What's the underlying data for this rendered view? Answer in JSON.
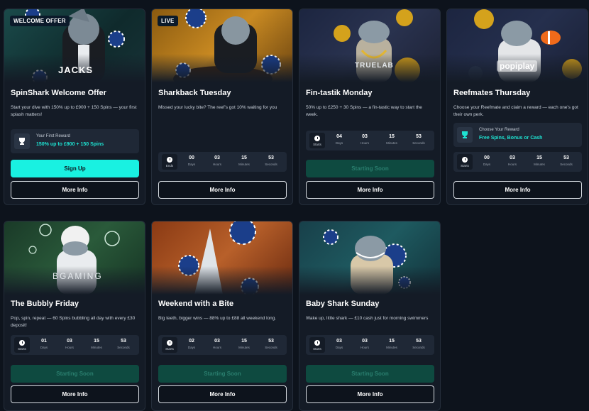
{
  "cards": [
    {
      "badge": "WELCOME OFFER",
      "title": "SpinShark Welcome Offer",
      "desc": "Start your dive with 150% up to £900 + 150 Spins — your first splash matters!",
      "reward_label": "Your First Reward",
      "reward_value": "150% up to £900 + 150 Spins",
      "signup_label": "Sign Up",
      "info_label": "More Info",
      "art_text": "JACKS"
    },
    {
      "badge": "LIVE",
      "title": "Sharkback Tuesday",
      "desc": "Missed your lucky bite? The reef's got 10% waiting for you",
      "timer_label": "Ends",
      "timer": [
        "00",
        "03",
        "15",
        "53"
      ],
      "info_label": "More Info"
    },
    {
      "title": "Fin-tastik Monday",
      "desc": "50% up to £250 + 30 Spins — a fin-tastic way to start the week.",
      "timer_label": "Starts",
      "timer": [
        "04",
        "03",
        "15",
        "53"
      ],
      "soon_label": "Starting Soon",
      "info_label": "More Info",
      "art_text": "TRUELAB"
    },
    {
      "title": "Reefmates Thursday",
      "desc": "Choose your Reefmate and claim a reward — each one's got their own perk.",
      "reward_label": "Choose Your Reward",
      "reward_value": "Free Spins, Bonus or Cash",
      "timer_label": "Starts",
      "timer": [
        "00",
        "03",
        "15",
        "53"
      ],
      "info_label": "More Info",
      "art_text": "popiplay"
    },
    {
      "title": "The Bubbly Friday",
      "desc": "Pop, spin, repeat — 60 Spins bubbling all day with every £30 deposit!",
      "timer_label": "Starts",
      "timer": [
        "01",
        "03",
        "15",
        "53"
      ],
      "soon_label": "Starting Soon",
      "info_label": "More Info",
      "art_text": "BGAMING"
    },
    {
      "title": "Weekend with a Bite",
      "desc": "Big teeth, bigger wins — 88% up to £88 all weekend long.",
      "timer_label": "Starts",
      "timer": [
        "02",
        "03",
        "15",
        "53"
      ],
      "soon_label": "Starting Soon",
      "info_label": "More Info"
    },
    {
      "title": "Baby Shark Sunday",
      "desc": "Wake up, little shark — £10 cash just for morning swimmers",
      "timer_label": "Starts",
      "timer": [
        "03",
        "03",
        "15",
        "53"
      ],
      "soon_label": "Starting Soon",
      "info_label": "More Info"
    }
  ],
  "units": [
    "Days",
    "Hours",
    "Minutes",
    "Seconds"
  ],
  "colors": {
    "accent": "#19f1e1",
    "reward_text": "#1ee3d2",
    "soon_bg": "#0e4a40",
    "bg": "#0d131c",
    "card": "#141b26"
  }
}
